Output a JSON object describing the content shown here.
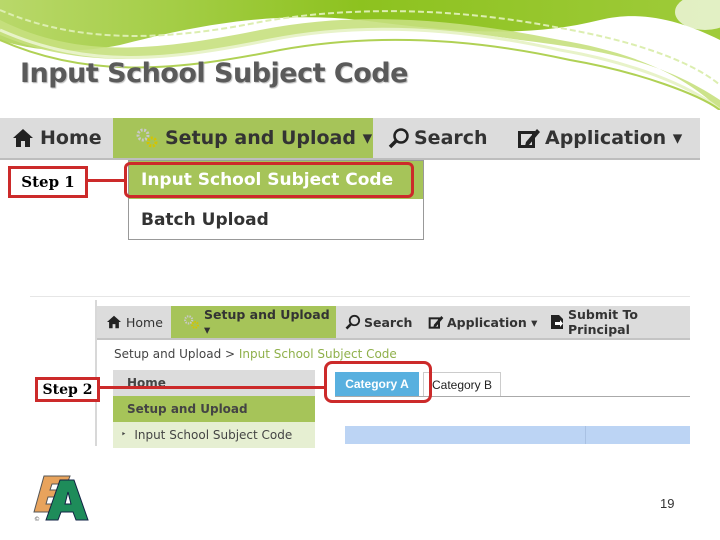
{
  "slide": {
    "title": "Input School Subject Code",
    "page_number": "19",
    "accent_color": "#8dc21f"
  },
  "step1": {
    "label": "Step 1",
    "nav": {
      "items": [
        {
          "label": "Home",
          "icon": "home-icon"
        },
        {
          "label": "Setup and Upload ▾",
          "icon": "gears-icon",
          "active": true
        },
        {
          "label": "Search",
          "icon": "search-icon"
        },
        {
          "label": "Application ▾",
          "icon": "edit-icon"
        }
      ]
    },
    "dropdown": {
      "items": [
        {
          "label": "Input School  Subject Code",
          "selected": true
        },
        {
          "label": "Batch Upload"
        }
      ]
    }
  },
  "step2": {
    "label": "Step 2",
    "nav": {
      "items": [
        {
          "label": "Home",
          "icon": "home-icon"
        },
        {
          "label": "Setup and Upload ▾",
          "icon": "gears-icon",
          "active": true
        },
        {
          "label": "Search",
          "icon": "search-icon"
        },
        {
          "label": "Application ▾",
          "icon": "edit-icon"
        },
        {
          "label": "Submit To Principal",
          "icon": "submit-icon"
        }
      ]
    },
    "breadcrumb": {
      "parent": "Setup and Upload",
      "separator": " > ",
      "current": "Input School Subject Code"
    },
    "sidebar": {
      "items": [
        {
          "label": "Home"
        },
        {
          "label": "Setup and Upload"
        },
        {
          "label": "Input School Subject Code",
          "bullet": "‣"
        }
      ]
    },
    "tabs": [
      {
        "label": "Category A",
        "active": true
      },
      {
        "label": "Category B"
      }
    ]
  },
  "logo": {
    "text_e": "E",
    "text_a": "A",
    "copyright": "©"
  }
}
